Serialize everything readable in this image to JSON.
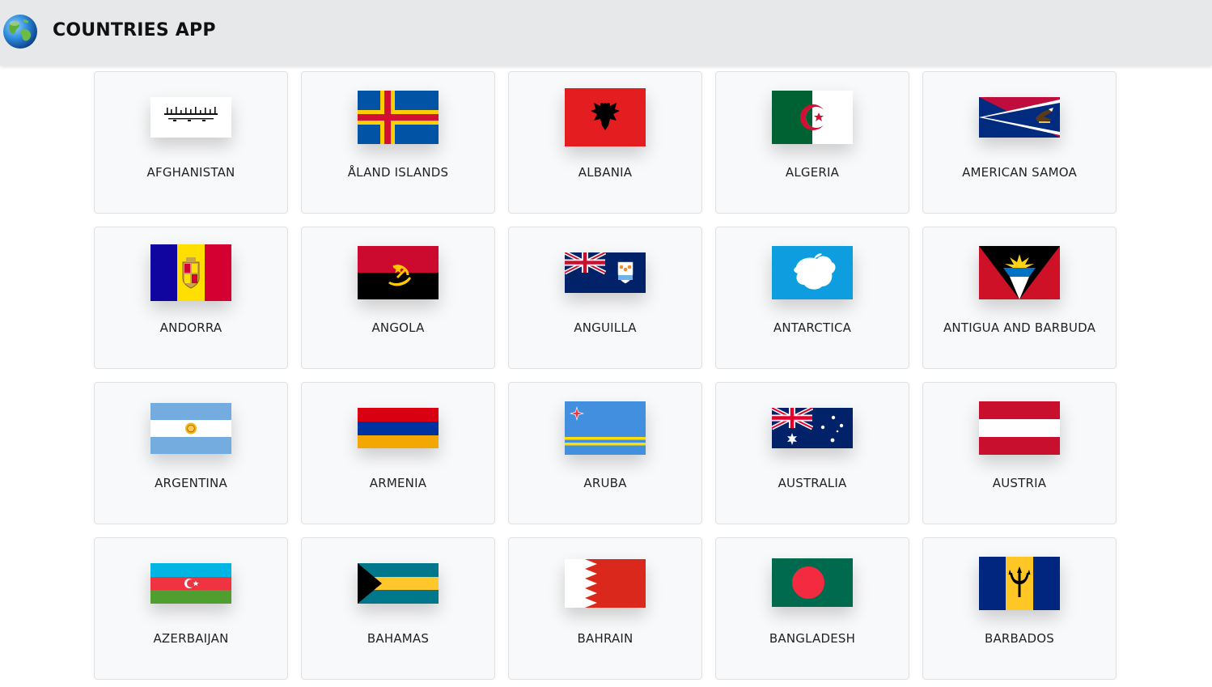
{
  "header": {
    "title": "COUNTRIES APP",
    "logo_icon": "globe-icon"
  },
  "countries": [
    {
      "name": "AFGHANISTAN",
      "flag": "afghanistan-flag"
    },
    {
      "name": "ÅLAND ISLANDS",
      "flag": "aland-islands-flag"
    },
    {
      "name": "ALBANIA",
      "flag": "albania-flag"
    },
    {
      "name": "ALGERIA",
      "flag": "algeria-flag"
    },
    {
      "name": "AMERICAN SAMOA",
      "flag": "american-samoa-flag"
    },
    {
      "name": "ANDORRA",
      "flag": "andorra-flag"
    },
    {
      "name": "ANGOLA",
      "flag": "angola-flag"
    },
    {
      "name": "ANGUILLA",
      "flag": "anguilla-flag"
    },
    {
      "name": "ANTARCTICA",
      "flag": "antarctica-flag"
    },
    {
      "name": "ANTIGUA AND BARBUDA",
      "flag": "antigua-and-barbuda-flag"
    },
    {
      "name": "ARGENTINA",
      "flag": "argentina-flag"
    },
    {
      "name": "ARMENIA",
      "flag": "armenia-flag"
    },
    {
      "name": "ARUBA",
      "flag": "aruba-flag"
    },
    {
      "name": "AUSTRALIA",
      "flag": "australia-flag"
    },
    {
      "name": "AUSTRIA",
      "flag": "austria-flag"
    },
    {
      "name": "AZERBAIJAN",
      "flag": "azerbaijan-flag"
    },
    {
      "name": "BAHAMAS",
      "flag": "bahamas-flag"
    },
    {
      "name": "BAHRAIN",
      "flag": "bahrain-flag"
    },
    {
      "name": "BANGLADESH",
      "flag": "bangladesh-flag"
    },
    {
      "name": "BARBADOS",
      "flag": "barbados-flag"
    }
  ],
  "colors": {
    "header_bg": "#e7e8ea",
    "card_bg": "#f8f9fa",
    "card_border": "#dfe1e4",
    "text": "#222222"
  }
}
